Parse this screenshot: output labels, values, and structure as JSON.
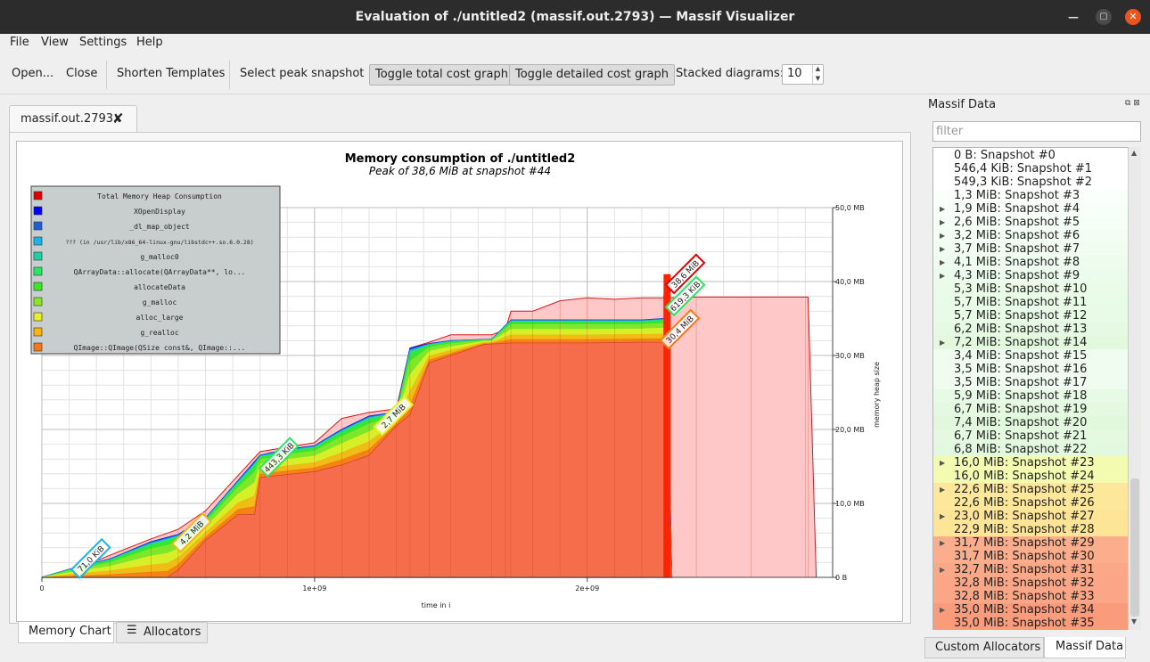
{
  "window": {
    "title": "Evaluation of ./untitled2 (massif.out.2793) — Massif Visualizer"
  },
  "menu": {
    "file": "File",
    "view": "View",
    "settings": "Settings",
    "help": "Help"
  },
  "toolbar": {
    "open": "Open...",
    "close": "Close",
    "shorten": "Shorten Templates",
    "peak": "Select peak snapshot",
    "toggle_total": "Toggle total cost graph",
    "toggle_detailed": "Toggle detailed cost graph",
    "stacked_label": "Stacked diagrams:",
    "stacked_value": "10"
  },
  "document_tab": {
    "label": "massif.out.2793"
  },
  "bottom_tabs": {
    "memory_chart": "Memory Chart",
    "allocators": "Allocators"
  },
  "dock": {
    "title": "Massif Data",
    "filter_placeholder": "filter",
    "tab_custom": "Custom Allocators",
    "tab_massif": "Massif Data"
  },
  "snapshots": [
    {
      "label": "0 B: Snapshot #0",
      "expand": false,
      "color": "#ffffff"
    },
    {
      "label": "546,4 KiB: Snapshot #1",
      "expand": false,
      "color": "#ffffff"
    },
    {
      "label": "549,3 KiB: Snapshot #2",
      "expand": false,
      "color": "#ffffff"
    },
    {
      "label": "1,3 MiB: Snapshot #3",
      "expand": false,
      "color": "#fbfffb"
    },
    {
      "label": "1,9 MiB: Snapshot #4",
      "expand": true,
      "color": "#f8fff8"
    },
    {
      "label": "2,6 MiB: Snapshot #5",
      "expand": true,
      "color": "#f6fff6"
    },
    {
      "label": "3,2 MiB: Snapshot #6",
      "expand": true,
      "color": "#f3fdf3"
    },
    {
      "label": "3,7 MiB: Snapshot #7",
      "expand": true,
      "color": "#f1fdf1"
    },
    {
      "label": "4,1 MiB: Snapshot #8",
      "expand": true,
      "color": "#eefcee"
    },
    {
      "label": "4,3 MiB: Snapshot #9",
      "expand": true,
      "color": "#ecfcec"
    },
    {
      "label": "5,3 MiB: Snapshot #10",
      "expand": false,
      "color": "#eafbe8"
    },
    {
      "label": "5,7 MiB: Snapshot #11",
      "expand": false,
      "color": "#e8fbe6"
    },
    {
      "label": "5,7 MiB: Snapshot #12",
      "expand": false,
      "color": "#e8fbe6"
    },
    {
      "label": "6,2 MiB: Snapshot #13",
      "expand": false,
      "color": "#e6fae3"
    },
    {
      "label": "7,2 MiB: Snapshot #14",
      "expand": true,
      "color": "#e2f9de"
    },
    {
      "label": "3,4 MiB: Snapshot #15",
      "expand": false,
      "color": "#f0fcf0"
    },
    {
      "label": "3,5 MiB: Snapshot #16",
      "expand": false,
      "color": "#effcef"
    },
    {
      "label": "3,5 MiB: Snapshot #17",
      "expand": false,
      "color": "#effcef"
    },
    {
      "label": "5,9 MiB: Snapshot #18",
      "expand": false,
      "color": "#e7fae5"
    },
    {
      "label": "6,7 MiB: Snapshot #19",
      "expand": false,
      "color": "#e4f9e0"
    },
    {
      "label": "7,4 MiB: Snapshot #20",
      "expand": false,
      "color": "#e1f8dc"
    },
    {
      "label": "6,7 MiB: Snapshot #21",
      "expand": false,
      "color": "#e4f9e0"
    },
    {
      "label": "6,8 MiB: Snapshot #22",
      "expand": false,
      "color": "#e3f9df"
    },
    {
      "label": "16,0 MiB: Snapshot #23",
      "expand": true,
      "color": "#f3fbb0"
    },
    {
      "label": "16,0 MiB: Snapshot #24",
      "expand": false,
      "color": "#f3fbb0"
    },
    {
      "label": "22,6 MiB: Snapshot #25",
      "expand": true,
      "color": "#fde79a"
    },
    {
      "label": "22,6 MiB: Snapshot #26",
      "expand": false,
      "color": "#fde79a"
    },
    {
      "label": "23,0 MiB: Snapshot #27",
      "expand": true,
      "color": "#fde497"
    },
    {
      "label": "22,9 MiB: Snapshot #28",
      "expand": false,
      "color": "#fde598"
    },
    {
      "label": "31,7 MiB: Snapshot #29",
      "expand": true,
      "color": "#fbad8c"
    },
    {
      "label": "31,7 MiB: Snapshot #30",
      "expand": false,
      "color": "#fbad8c"
    },
    {
      "label": "32,7 MiB: Snapshot #31",
      "expand": true,
      "color": "#fba888"
    },
    {
      "label": "32,8 MiB: Snapshot #32",
      "expand": false,
      "color": "#fba787"
    },
    {
      "label": "32,8 MiB: Snapshot #33",
      "expand": false,
      "color": "#fba787"
    },
    {
      "label": "35,0 MiB: Snapshot #34",
      "expand": true,
      "color": "#fa9b7c"
    },
    {
      "label": "35,0 MiB: Snapshot #35",
      "expand": false,
      "color": "#fa9b7c"
    }
  ],
  "chart_data": {
    "type": "area",
    "title": "Memory consumption of ./untitled2",
    "subtitle": "Peak of 38,6 MiB at snapshot #44",
    "xlabel": "time in i",
    "ylabel": "memory heap size",
    "xlim": [
      0,
      2900000000.0
    ],
    "ylim": [
      0,
      50
    ],
    "x_ticks": [
      "0",
      "1e+09",
      "2e+09"
    ],
    "x_tick_values": [
      0,
      1000000000.0,
      2000000000.0
    ],
    "y_ticks": [
      "0 B",
      "10,0 MB",
      "20,0 MB",
      "30,0 MB",
      "40,0 MB",
      "50,0 MB"
    ],
    "y_tick_values": [
      0,
      10,
      20,
      30,
      40,
      50
    ],
    "grid": true,
    "legend_position": "top-left",
    "legend": [
      {
        "name": "Total Memory Heap Consumption",
        "color": "#e00000"
      },
      {
        "name": "XOpenDisplay",
        "color": "#0000ff"
      },
      {
        "name": "_dl_map_object",
        "color": "#1e5fd2"
      },
      {
        "name": "??? (in /usr/lib/x86_64-linux-gnu/libstdc++.so.6.0.28)",
        "color": "#1ab4e6"
      },
      {
        "name": "g_malloc0",
        "color": "#1ed2a0"
      },
      {
        "name": "QArrayData::allocate(QArrayData**, lo...",
        "color": "#28e664"
      },
      {
        "name": "allocateData",
        "color": "#3ce628"
      },
      {
        "name": "g_malloc",
        "color": "#8ce628"
      },
      {
        "name": "alloc_large",
        "color": "#e6f028"
      },
      {
        "name": "g_realloc",
        "color": "#f5b414"
      },
      {
        "name": "QImage::QImage(QSize const&, QImage::...",
        "color": "#f57814"
      }
    ],
    "total": {
      "x": [
        0,
        120000000.0,
        250000000.0,
        400000000.0,
        500000000.0,
        600000000.0,
        800000000.0,
        900000000.0,
        1000000000.0,
        1100000000.0,
        1200000000.0,
        1300000000.0,
        1350000000.0,
        1420000000.0,
        1500000000.0,
        1650000000.0,
        1700000000.0,
        1720000000.0,
        1800000000.0,
        1900000000.0,
        2000000000.0,
        2100000000.0,
        2200000000.0,
        2280000000.0,
        2290000000.0,
        2300000000.0,
        2400000000.0,
        2600000000.0,
        2800000000.0,
        2810000000.0,
        2840000000.0
      ],
      "y": [
        0,
        1.0,
        3.0,
        5.2,
        6.5,
        9.0,
        17.0,
        17.6,
        18.2,
        21.5,
        22.3,
        22.8,
        31.0,
        31.8,
        32.8,
        32.8,
        33.5,
        36.0,
        36.0,
        37.4,
        37.8,
        37.6,
        37.8,
        37.8,
        40.5,
        37.8,
        37.9,
        37.9,
        37.9,
        37.9,
        0
      ]
    },
    "stack_total": {
      "x": [
        0,
        120000000.0,
        250000000.0,
        400000000.0,
        500000000.0,
        600000000.0,
        800000000.0,
        900000000.0,
        1000000000.0,
        1100000000.0,
        1200000000.0,
        1300000000.0,
        1350000000.0,
        1420000000.0,
        1500000000.0,
        1650000000.0,
        1720000000.0,
        2000000000.0,
        2200000000.0,
        2290000000.0,
        2310000000.0
      ],
      "y": [
        0,
        1.3,
        2.5,
        4.8,
        5.8,
        8.0,
        16.5,
        17.3,
        17.8,
        20.0,
        21.8,
        22.3,
        31.0,
        31.6,
        32.0,
        32.2,
        34.8,
        34.8,
        34.8,
        35.0,
        0
      ]
    },
    "stack_bottom": {
      "x": [
        0,
        460000000.0,
        500000000.0,
        600000000.0,
        720000000.0,
        780000000.0,
        800000000.0,
        1000000000.0,
        1100000000.0,
        1200000000.0,
        1300000000.0,
        1350000000.0,
        1420000000.0,
        1500000000.0,
        1620000000.0,
        1720000000.0,
        2000000000.0,
        2200000000.0,
        2290000000.0,
        2310000000.0
      ],
      "y": [
        0,
        0,
        1.0,
        5.0,
        8.5,
        8.5,
        13.5,
        14.3,
        15.2,
        16.5,
        20.5,
        22.0,
        29.0,
        30.0,
        31.5,
        31.7,
        31.7,
        31.8,
        31.8,
        0
      ]
    },
    "annotations": [
      {
        "text": "71,0 KiB",
        "x": 180000000.0,
        "y": 2.5,
        "color": "#1ab4e6"
      },
      {
        "text": "4,2 MiB",
        "x": 550000000.0,
        "y": 6.0,
        "color": "#f5b414"
      },
      {
        "text": "443,3 KiB",
        "x": 870000000.0,
        "y": 16.2,
        "color": "#28e664"
      },
      {
        "text": "2,7 MiB",
        "x": 1290000000.0,
        "y": 21.8,
        "color": "#e6f028"
      },
      {
        "text": "38,6 MiB",
        "x": 2360000000.0,
        "y": 41.0,
        "color": "#e00000"
      },
      {
        "text": "619,3 KiB",
        "x": 2360000000.0,
        "y": 38.0,
        "color": "#28e664"
      },
      {
        "text": "30,4 MiB",
        "x": 2340000000.0,
        "y": 33.5,
        "color": "#f57814"
      }
    ]
  }
}
